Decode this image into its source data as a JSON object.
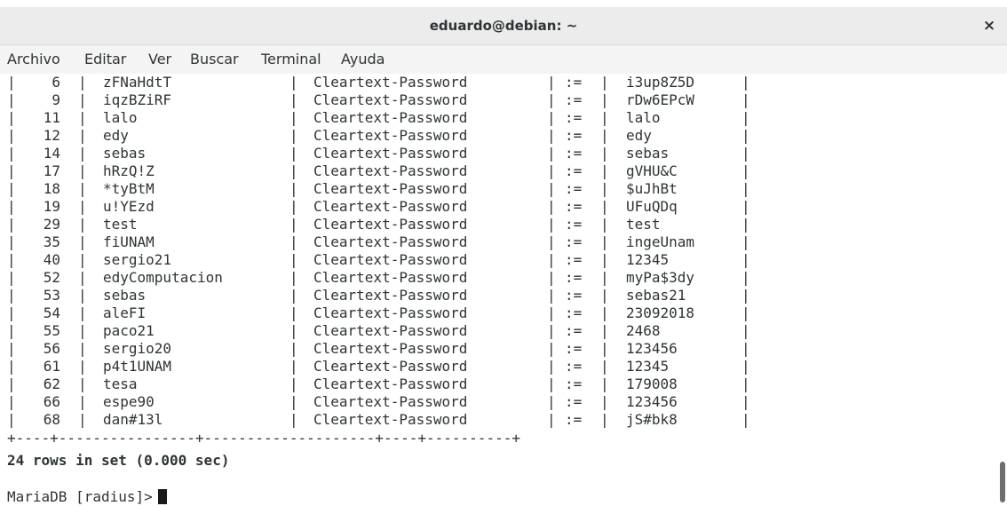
{
  "window": {
    "title": "eduardo@debian: ~",
    "close_label": "×"
  },
  "menu": {
    "items": [
      "Archivo",
      "Editar",
      "Ver",
      "Buscar",
      "Terminal",
      "Ayuda"
    ]
  },
  "table": {
    "rows": [
      {
        "id": "6",
        "username": "zFNaHdtT",
        "attribute": "Cleartext-Password",
        "op": ":=",
        "value": "i3up8Z5D"
      },
      {
        "id": "9",
        "username": "iqzBZiRF",
        "attribute": "Cleartext-Password",
        "op": ":=",
        "value": "rDw6EPcW"
      },
      {
        "id": "11",
        "username": "lalo",
        "attribute": "Cleartext-Password",
        "op": ":=",
        "value": "lalo"
      },
      {
        "id": "12",
        "username": "edy",
        "attribute": "Cleartext-Password",
        "op": ":=",
        "value": "edy"
      },
      {
        "id": "14",
        "username": "sebas",
        "attribute": "Cleartext-Password",
        "op": ":=",
        "value": "sebas"
      },
      {
        "id": "17",
        "username": "hRzQ!Z",
        "attribute": "Cleartext-Password",
        "op": ":=",
        "value": "gVHU&C"
      },
      {
        "id": "18",
        "username": "*tyBtM",
        "attribute": "Cleartext-Password",
        "op": ":=",
        "value": "$uJhBt"
      },
      {
        "id": "19",
        "username": "u!YEzd",
        "attribute": "Cleartext-Password",
        "op": ":=",
        "value": "UFuQDq"
      },
      {
        "id": "29",
        "username": "test",
        "attribute": "Cleartext-Password",
        "op": ":=",
        "value": "test"
      },
      {
        "id": "35",
        "username": "fiUNAM",
        "attribute": "Cleartext-Password",
        "op": ":=",
        "value": "ingeUnam"
      },
      {
        "id": "40",
        "username": "sergio21",
        "attribute": "Cleartext-Password",
        "op": ":=",
        "value": "12345"
      },
      {
        "id": "52",
        "username": "edyComputacion",
        "attribute": "Cleartext-Password",
        "op": ":=",
        "value": "myPa$3dy"
      },
      {
        "id": "53",
        "username": "sebas",
        "attribute": "Cleartext-Password",
        "op": ":=",
        "value": "sebas21"
      },
      {
        "id": "54",
        "username": "aleFI",
        "attribute": "Cleartext-Password",
        "op": ":=",
        "value": "23092018"
      },
      {
        "id": "55",
        "username": "paco21",
        "attribute": "Cleartext-Password",
        "op": ":=",
        "value": "2468"
      },
      {
        "id": "56",
        "username": "sergio20",
        "attribute": "Cleartext-Password",
        "op": ":=",
        "value": "123456"
      },
      {
        "id": "61",
        "username": "p4t1UNAM",
        "attribute": "Cleartext-Password",
        "op": ":=",
        "value": "12345"
      },
      {
        "id": "62",
        "username": "tesa",
        "attribute": "Cleartext-Password",
        "op": ":=",
        "value": "179008"
      },
      {
        "id": "66",
        "username": "espe90",
        "attribute": "Cleartext-Password",
        "op": ":=",
        "value": "123456"
      },
      {
        "id": "68",
        "username": "dan#13l",
        "attribute": "Cleartext-Password",
        "op": ":=",
        "value": "jS#bk8"
      }
    ],
    "border_line": "+----+----------------+--------------------+----+----------+",
    "summary": "24 rows in set (0.000 sec)"
  },
  "prompt": {
    "text": "MariaDB [radius]>"
  }
}
